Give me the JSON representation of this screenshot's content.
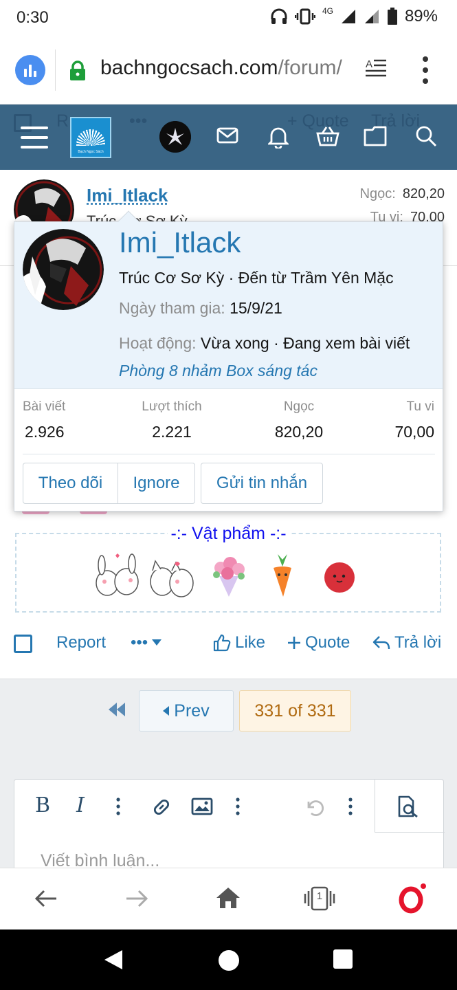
{
  "status_bar": {
    "time": "0:30",
    "battery": "89%",
    "network": "4G"
  },
  "browser": {
    "url_domain": "bachngocsach.com",
    "url_path": "/forum/"
  },
  "site_header": {
    "logo_text": "Bạch Ngọc Sách",
    "ghost_row": {
      "report_fragment": "R",
      "more": "•••",
      "quote": "+ Quote",
      "reply": "Trả lời"
    }
  },
  "post": {
    "username": "Imi_Itlack",
    "rank_partial": "Trúc Cơ Sơ Kỳ",
    "stats": [
      {
        "label": "Ngọc:",
        "value": "820,20"
      },
      {
        "label": "Tu vi:",
        "value": "70,00"
      }
    ],
    "items_title": "-:- Vật phẩm -:-",
    "items": [
      "bunnies-kiss-sticker",
      "cats-hug-sticker",
      "flower-bouquet-sticker",
      "carrot-sticker",
      "red-ball-sticker"
    ],
    "actions": {
      "report": "Report",
      "more": "•••",
      "like": "Like",
      "quote": "Quote",
      "reply": "Trả lời"
    }
  },
  "pagination": {
    "prev": "Prev",
    "current": "331 of 331"
  },
  "editor": {
    "bold": "B",
    "italic": "I",
    "placeholder": "Viết bình luận..."
  },
  "member_card": {
    "name": "Imi_Itlack",
    "rank_line": "Trúc Cơ Sơ Kỳ · Đến từ Trầm Yên Mặc",
    "joined_label": "Ngày tham gia:",
    "joined_value": "15/9/21",
    "activity_label": "Hoạt động:",
    "activity_value": "Vừa xong · Đang xem bài viết",
    "activity_link": "Phòng 8 nhảm Box sáng tác",
    "stats": [
      {
        "label": "Bài viết",
        "value": "2.926"
      },
      {
        "label": "Lượt thích",
        "value": "2.221"
      },
      {
        "label": "Ngọc",
        "value": "820,20"
      },
      {
        "label": "Tu vi",
        "value": "70,00"
      }
    ],
    "buttons": {
      "follow": "Theo dõi",
      "ignore": "Ignore",
      "message": "Gửi tin nhắn"
    }
  },
  "bottom_bar": {
    "tabs_count": "1"
  },
  "colors": {
    "header_bg": "#3a6585",
    "link": "#2577b1",
    "card_head_bg": "#eaf3fb",
    "current_page_bg": "#fef4e4",
    "items_title": "#1010ee"
  }
}
